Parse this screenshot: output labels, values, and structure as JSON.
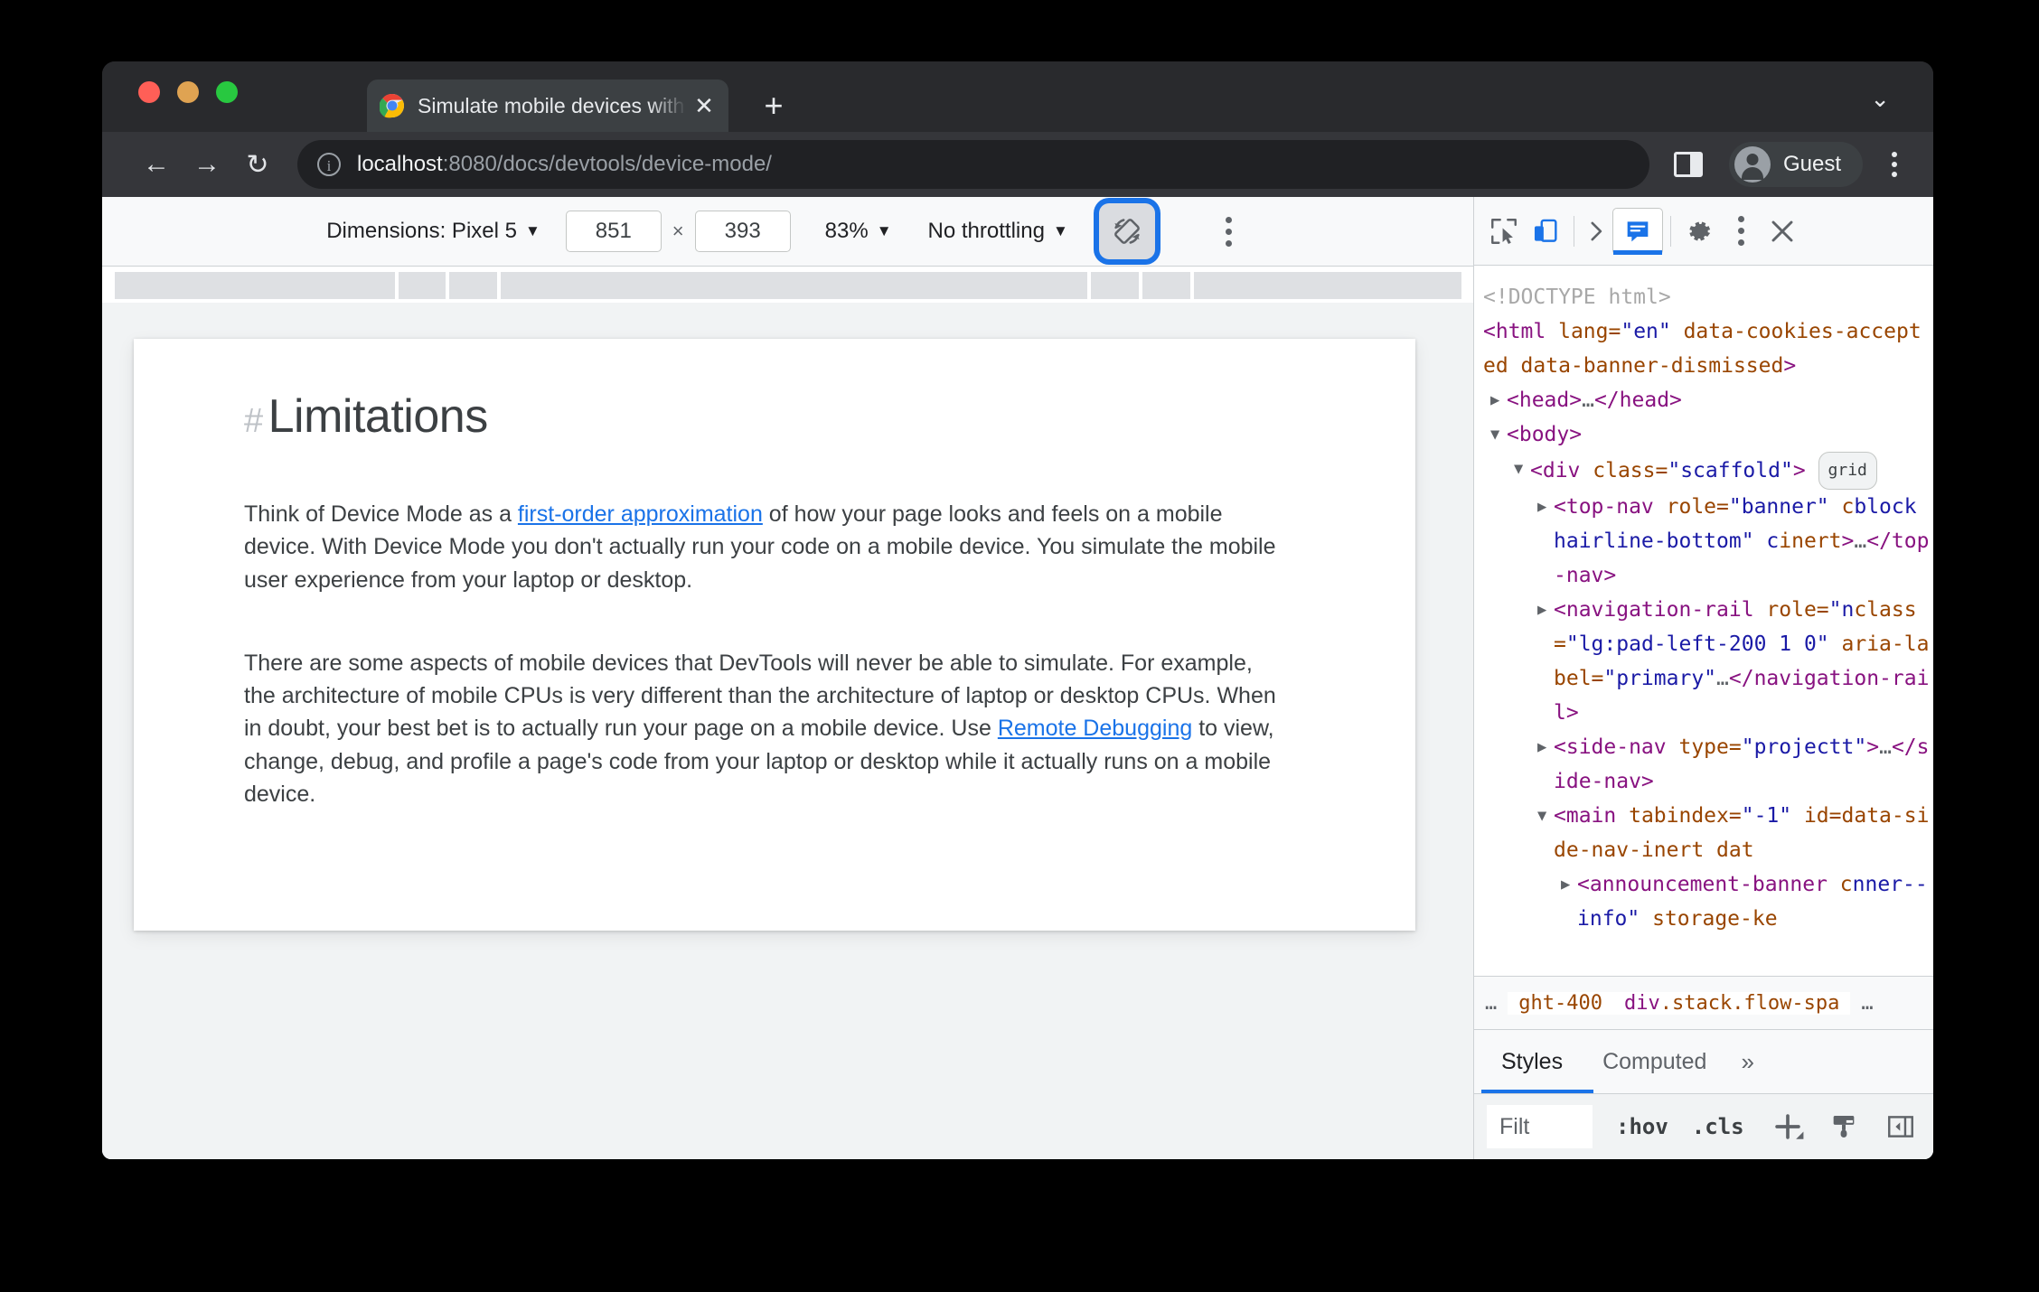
{
  "browser": {
    "tab": {
      "title": "Simulate mobile devices with DevTools",
      "close_label": "✕"
    },
    "new_tab_label": "+",
    "window_chevron": "⌄",
    "nav": {
      "back": "←",
      "forward": "→",
      "reload": "↻"
    },
    "url": {
      "host": "localhost",
      "path": ":8080/docs/devtools/device-mode/",
      "info_icon": "i"
    },
    "profile_label": "Guest"
  },
  "device_toolbar": {
    "dimensions_label": "Dimensions: Pixel 5",
    "caret": "▼",
    "width": "851",
    "height": "393",
    "multiply": "×",
    "zoom": "83%",
    "throttling": "No throttling"
  },
  "page": {
    "heading": "Limitations",
    "heading_hash": "#",
    "paragraphs": [
      {
        "before": "Think of Device Mode as a ",
        "link": "first-order approximation",
        "after": " of how your page looks and feels on a mobile device. With Device Mode you don't actually run your code on a mobile device. You simulate the mobile user experience from your laptop or desktop."
      },
      {
        "before": "There are some aspects of mobile devices that DevTools will never be able to simulate. For example, the architecture of mobile CPUs is very different than the architecture of laptop or desktop CPUs. When in doubt, your best bet is to actually run your page on a mobile device. Use ",
        "link": "Remote Debugging",
        "after": " to view, change, debug, and profile a page's code from your laptop or desktop while it actually runs on a mobile device."
      }
    ]
  },
  "devtools": {
    "dom": {
      "lines": [
        {
          "indent": 0,
          "twisty": "",
          "parts": [
            {
              "c": "dc",
              "t": "<!DOCTYPE html>"
            }
          ]
        },
        {
          "indent": 0,
          "twisty": "",
          "wrap": true,
          "parts": [
            {
              "c": "tg",
              "t": "<html "
            },
            {
              "c": "at",
              "t": "lang="
            },
            {
              "c": "va",
              "t": "\"en\""
            },
            {
              "c": "at",
              "t": " data-cookies-accepted data-banner-dismissed"
            },
            {
              "c": "tg",
              "t": ">"
            }
          ]
        },
        {
          "indent": 1,
          "twisty": "▶",
          "parts": [
            {
              "c": "tg",
              "t": "<head>"
            },
            {
              "c": "el",
              "t": "…"
            },
            {
              "c": "tg",
              "t": "</head>"
            }
          ]
        },
        {
          "indent": 1,
          "twisty": "▼",
          "parts": [
            {
              "c": "tg",
              "t": "<body>"
            }
          ]
        },
        {
          "indent": 2,
          "twisty": "▼",
          "badge": "grid",
          "parts": [
            {
              "c": "tg",
              "t": "<div "
            },
            {
              "c": "at",
              "t": "class="
            },
            {
              "c": "va",
              "t": "\"scaffold\""
            },
            {
              "c": "tg",
              "t": ">"
            }
          ]
        },
        {
          "indent": 3,
          "twisty": "▶",
          "wrap": true,
          "parts": [
            {
              "c": "tg",
              "t": "<top-nav "
            },
            {
              "c": "at",
              "t": "role="
            },
            {
              "c": "va",
              "t": "\"banner\""
            },
            {
              "c": "at",
              "t": " c"
            },
            {
              "c": "va",
              "t": "block hairline-bottom\" c"
            },
            {
              "c": "at",
              "t": "inert"
            },
            {
              "c": "tg",
              "t": ">"
            },
            {
              "c": "el",
              "t": "…"
            },
            {
              "c": "tg",
              "t": "</top-nav>"
            }
          ]
        },
        {
          "indent": 3,
          "twisty": "▶",
          "wrap": true,
          "parts": [
            {
              "c": "tg",
              "t": "<navigation-rail "
            },
            {
              "c": "at",
              "t": "role="
            },
            {
              "c": "va",
              "t": "\"n"
            },
            {
              "c": "at",
              "t": "class="
            },
            {
              "c": "va",
              "t": "\"lg:pad-left-200 1 0\""
            },
            {
              "c": "at",
              "t": " aria-label="
            },
            {
              "c": "va",
              "t": "\"primary\""
            },
            {
              "c": "el",
              "t": "…"
            },
            {
              "c": "tg",
              "t": "</navigation-rail>"
            }
          ]
        },
        {
          "indent": 3,
          "twisty": "▶",
          "wrap": true,
          "parts": [
            {
              "c": "tg",
              "t": "<side-nav "
            },
            {
              "c": "at",
              "t": "type="
            },
            {
              "c": "va",
              "t": "\"project"
            },
            {
              "c": "va",
              "t": "t\""
            },
            {
              "c": "tg",
              "t": ">"
            },
            {
              "c": "el",
              "t": "…"
            },
            {
              "c": "tg",
              "t": "</side-nav>"
            }
          ]
        },
        {
          "indent": 3,
          "twisty": "▼",
          "wrap": true,
          "parts": [
            {
              "c": "tg",
              "t": "<main "
            },
            {
              "c": "at",
              "t": "tabindex="
            },
            {
              "c": "va",
              "t": "\"-1\""
            },
            {
              "c": "at",
              "t": " id="
            },
            {
              "c": "at",
              "t": "data-side-nav-inert dat"
            }
          ]
        },
        {
          "indent": 4,
          "twisty": "▶",
          "wrap": true,
          "parts": [
            {
              "c": "tg",
              "t": "<announcement-banner "
            },
            {
              "c": "at",
              "t": "c"
            },
            {
              "c": "va",
              "t": "nner--info\""
            },
            {
              "c": "at",
              "t": " storage-ke"
            }
          ]
        }
      ]
    },
    "breadcrumb": {
      "left_ellipsis": "…",
      "prev": "ght-400",
      "selected_tag": "div",
      "selected_classes": ".stack.flow-spa",
      "right_ellipsis": "…"
    },
    "panel_tabs": [
      {
        "label": "Styles",
        "active": true
      },
      {
        "label": "Computed",
        "active": false
      }
    ],
    "panel_tabs_overflow": "»",
    "filter": {
      "placeholder": "Filt",
      "hov": ":hov",
      "cls": ".cls",
      "plus": "+"
    }
  },
  "colors": {
    "accent_blue": "#1a73e8",
    "tag_purple": "#881280",
    "attr_orange": "#994500",
    "value_blue": "#1a1aa6",
    "link_blue": "#1a73e8",
    "chrome_dark": "#292a2d"
  }
}
